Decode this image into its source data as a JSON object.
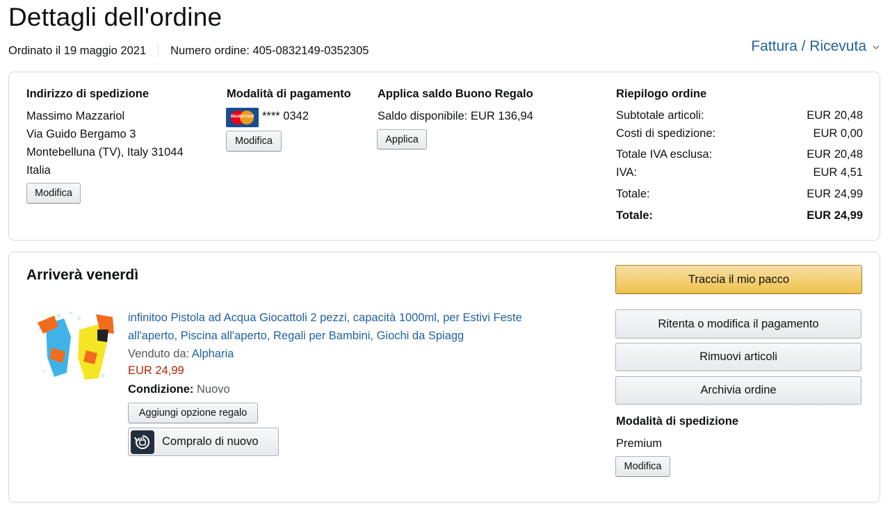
{
  "header": {
    "title": "Dettagli dell'ordine",
    "ordered_on": "Ordinato il 19 maggio 2021",
    "order_number": "Numero ordine: 405-0832149-0352305",
    "invoice_link": "Fattura / Ricevuta"
  },
  "shipping_address": {
    "heading": "Indirizzo di spedizione",
    "lines": [
      "Massimo Mazzariol",
      "Via Guido Bergamo 3",
      "Montebelluna (TV), Italy 31044",
      "Italia"
    ],
    "edit_label": "Modifica"
  },
  "payment": {
    "heading": "Modalità di pagamento",
    "card_brand": "MasterCard",
    "card_number": "**** 0342",
    "edit_label": "Modifica"
  },
  "gift_card": {
    "heading": "Applica saldo Buono Regalo",
    "balance": "Saldo disponibile: EUR 136,94",
    "apply_label": "Applica"
  },
  "summary": {
    "heading": "Riepilogo ordine",
    "rows": [
      {
        "label": "Subtotale articoli:",
        "value": "EUR 20,48"
      },
      {
        "label": "Costi di spedizione:",
        "value": "EUR 0,00"
      },
      {
        "label": "Totale IVA esclusa:",
        "value": "EUR 20,48"
      },
      {
        "label": "IVA:",
        "value": "EUR 4,51"
      },
      {
        "label": "Totale:",
        "value": "EUR 24,99"
      },
      {
        "label": "Totale:",
        "value": "EUR 24,99"
      }
    ]
  },
  "shipment": {
    "arrival": "Arriverà venerdì",
    "product_title": "infinitoo Pistola ad Acqua Giocattoli 2 pezzi, capacità 1000ml, per Estivi Feste all'aperto, Piscina all'aperto, Regali per Bambini, Giochi da Spiagg",
    "sold_by_label": "Venduto da:",
    "seller": "Alpharia",
    "price": "EUR 24,99",
    "condition_label": "Condizione:",
    "condition": "Nuovo",
    "gift_option_label": "Aggiungi opzione regalo",
    "buy_again_label": "Compralo di nuovo"
  },
  "actions": {
    "track": "Traccia il mio pacco",
    "retry_payment": "Ritenta o modifica il pagamento",
    "remove_items": "Rimuovi articoli",
    "archive": "Archivia ordine"
  },
  "shipping_method": {
    "heading": "Modalità di spedizione",
    "value": "Premium",
    "edit_label": "Modifica"
  },
  "colors": {
    "link": "#2162a1",
    "price": "#b12704",
    "primary_button": "#f0c14b"
  }
}
